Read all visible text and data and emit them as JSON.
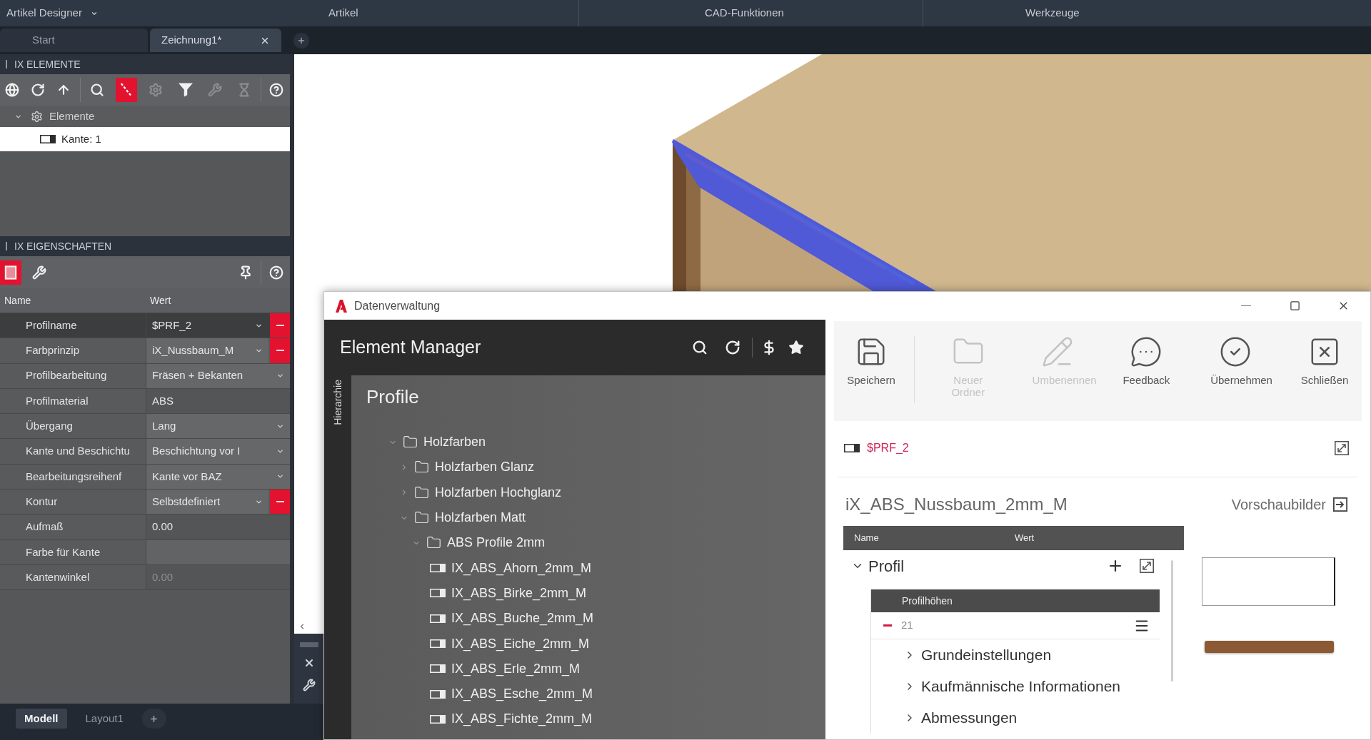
{
  "menu_bar": {
    "app_menu": "Artikel Designer",
    "panels": [
      "Artikel",
      "CAD-Funktionen",
      "Werkzeuge"
    ]
  },
  "document_tabs": [
    {
      "label": "Start",
      "selected": false,
      "closable": false
    },
    {
      "label": "Zeichnung1*",
      "selected": true,
      "closable": true
    }
  ],
  "elements_panel": {
    "title": "IX ELEMENTE",
    "toolbar": [
      {
        "buttons": [
          {
            "kind": "globe",
            "on": false,
            "disabled": false
          },
          {
            "kind": "refresh",
            "on": false,
            "disabled": false
          },
          {
            "kind": "up",
            "on": false,
            "disabled": false
          }
        ]
      },
      {
        "buttons": [
          {
            "kind": "search",
            "on": false,
            "disabled": false
          },
          {
            "kind": "pick",
            "on": true,
            "disabled": false
          },
          {
            "kind": "gear",
            "on": false,
            "disabled": true
          },
          {
            "kind": "funnel",
            "on": false,
            "disabled": false
          },
          {
            "kind": "wrench",
            "on": false,
            "disabled": true
          },
          {
            "kind": "hourglass",
            "on": false,
            "disabled": true
          }
        ]
      },
      {
        "buttons": [
          {
            "kind": "help",
            "on": false,
            "disabled": false
          }
        ]
      }
    ],
    "tree": [
      {
        "kind": "group",
        "label": "Elemente",
        "expanded": true,
        "selected": false,
        "children": [
          {
            "kind": "edge",
            "label": "Kante: 1",
            "selected": true
          }
        ]
      }
    ]
  },
  "properties_panel": {
    "title": "IX EIGENSCHAFTEN",
    "toolbar": [
      {
        "buttons": [
          {
            "kind": "list",
            "on": true
          },
          {
            "kind": "wrench",
            "on": false
          }
        ]
      },
      {
        "buttons": [
          {
            "kind": "pin",
            "on": false
          }
        ]
      },
      {
        "buttons": [
          {
            "kind": "help",
            "on": false
          }
        ]
      }
    ],
    "columns": [
      "Name",
      "Wert"
    ],
    "rows": [
      {
        "name": "Profilname",
        "value": "$PRF_2",
        "kind": "dropdown",
        "reset_button": true,
        "selected": true,
        "disabled": false
      },
      {
        "name": "Farbprinzip",
        "value": "iX_Nussbaum_M",
        "kind": "dropdown",
        "reset_button": true,
        "selected": false,
        "disabled": false
      },
      {
        "name": "Profilbearbeitung",
        "value": "Fräsen + Bekanten",
        "kind": "dropdown",
        "reset_button": false,
        "selected": false,
        "disabled": false
      },
      {
        "name": "Profilmaterial",
        "value": "ABS",
        "kind": "text",
        "reset_button": false,
        "selected": false,
        "disabled": false
      },
      {
        "name": "Übergang",
        "value": "Lang",
        "kind": "dropdown",
        "reset_button": false,
        "selected": false,
        "disabled": false
      },
      {
        "name": "Kante und Beschichtu",
        "value": "Beschichtung vor I",
        "kind": "dropdown",
        "reset_button": false,
        "selected": false,
        "disabled": false
      },
      {
        "name": "Bearbeitungsreihenf",
        "value": "Kante vor BAZ",
        "kind": "dropdown",
        "reset_button": false,
        "selected": false,
        "disabled": false
      },
      {
        "name": "Kontur",
        "value": "Selbstdefiniert",
        "kind": "dropdown",
        "reset_button": true,
        "selected": false,
        "disabled": false
      },
      {
        "name": "Aufmaß",
        "value": "0.00",
        "kind": "text",
        "reset_button": false,
        "selected": false,
        "disabled": false
      },
      {
        "name": "Farbe für Kante",
        "kind": "text",
        "reset_button": false,
        "selected": false,
        "disabled": false
      },
      {
        "name": "Kantenwinkel",
        "value": "0.00",
        "kind": "text",
        "reset_button": false,
        "selected": false,
        "disabled": true
      }
    ]
  },
  "layout_tabs": [
    {
      "label": "Modell",
      "selected": true
    },
    {
      "label": "Layout1",
      "selected": false
    }
  ],
  "dialog": {
    "title": "Datenverwaltung",
    "element_manager": {
      "title": "Element Manager",
      "side_tab": "Hierarchie",
      "tree_title": "Profile",
      "tree": [
        {
          "kind": "folder",
          "label": "Holzfarben",
          "expanded": true,
          "selected": false,
          "children": [
            {
              "kind": "folder",
              "label": "Holzfarben Glanz",
              "expanded": false,
              "selected": false
            },
            {
              "kind": "folder",
              "label": "Holzfarben Hochglanz",
              "expanded": false,
              "selected": false
            },
            {
              "kind": "folder",
              "label": "Holzfarben Matt",
              "expanded": true,
              "selected": false,
              "children": [
                {
                  "kind": "folder",
                  "label": "ABS Profile 2mm",
                  "expanded": true,
                  "selected": false,
                  "children": [
                    {
                      "kind": "profile",
                      "label": "IX_ABS_Ahorn_2mm_M",
                      "selected": false
                    },
                    {
                      "kind": "profile",
                      "label": "IX_ABS_Birke_2mm_M",
                      "selected": false
                    },
                    {
                      "kind": "profile",
                      "label": "IX_ABS_Buche_2mm_M",
                      "selected": false
                    },
                    {
                      "kind": "profile",
                      "label": "IX_ABS_Eiche_2mm_M",
                      "selected": false
                    },
                    {
                      "kind": "profile",
                      "label": "IX_ABS_Erle_2mm_M",
                      "selected": false
                    },
                    {
                      "kind": "profile",
                      "label": "IX_ABS_Esche_2mm_M",
                      "selected": false
                    },
                    {
                      "kind": "profile",
                      "label": "IX_ABS_Fichte_2mm_M",
                      "selected": false
                    }
                  ]
                }
              ]
            }
          ]
        }
      ]
    },
    "toolbar": [
      {
        "kind": "save",
        "label": "Speichern",
        "disabled": false
      },
      {
        "kind": "folder",
        "label": "Neuer Ordner",
        "disabled": true
      },
      {
        "kind": "rename",
        "label": "Umbenennen",
        "disabled": true
      },
      {
        "kind": "feedback",
        "label": "Feedback",
        "disabled": false
      },
      {
        "kind": "apply",
        "label": "Übernehmen",
        "disabled": false
      },
      {
        "kind": "close",
        "label": "Schließen",
        "disabled": false
      }
    ],
    "current_profile": "$PRF_2",
    "detail_title": "iX_ABS_Nussbaum_2mm_M",
    "preview_label": "Vorschaubilder",
    "grid": {
      "columns": [
        "Name",
        "Wert"
      ],
      "groups": [
        {
          "label": "Profil",
          "expanded": true,
          "heights": {
            "title": "Profilhöhen",
            "rows": [
              {
                "value": "21"
              }
            ]
          },
          "sections": [
            {
              "label": "Grundeinstellungen",
              "expanded": false
            },
            {
              "label": "Kaufmännische Informationen",
              "expanded": false
            },
            {
              "label": "Abmessungen",
              "expanded": false
            }
          ]
        }
      ]
    }
  }
}
